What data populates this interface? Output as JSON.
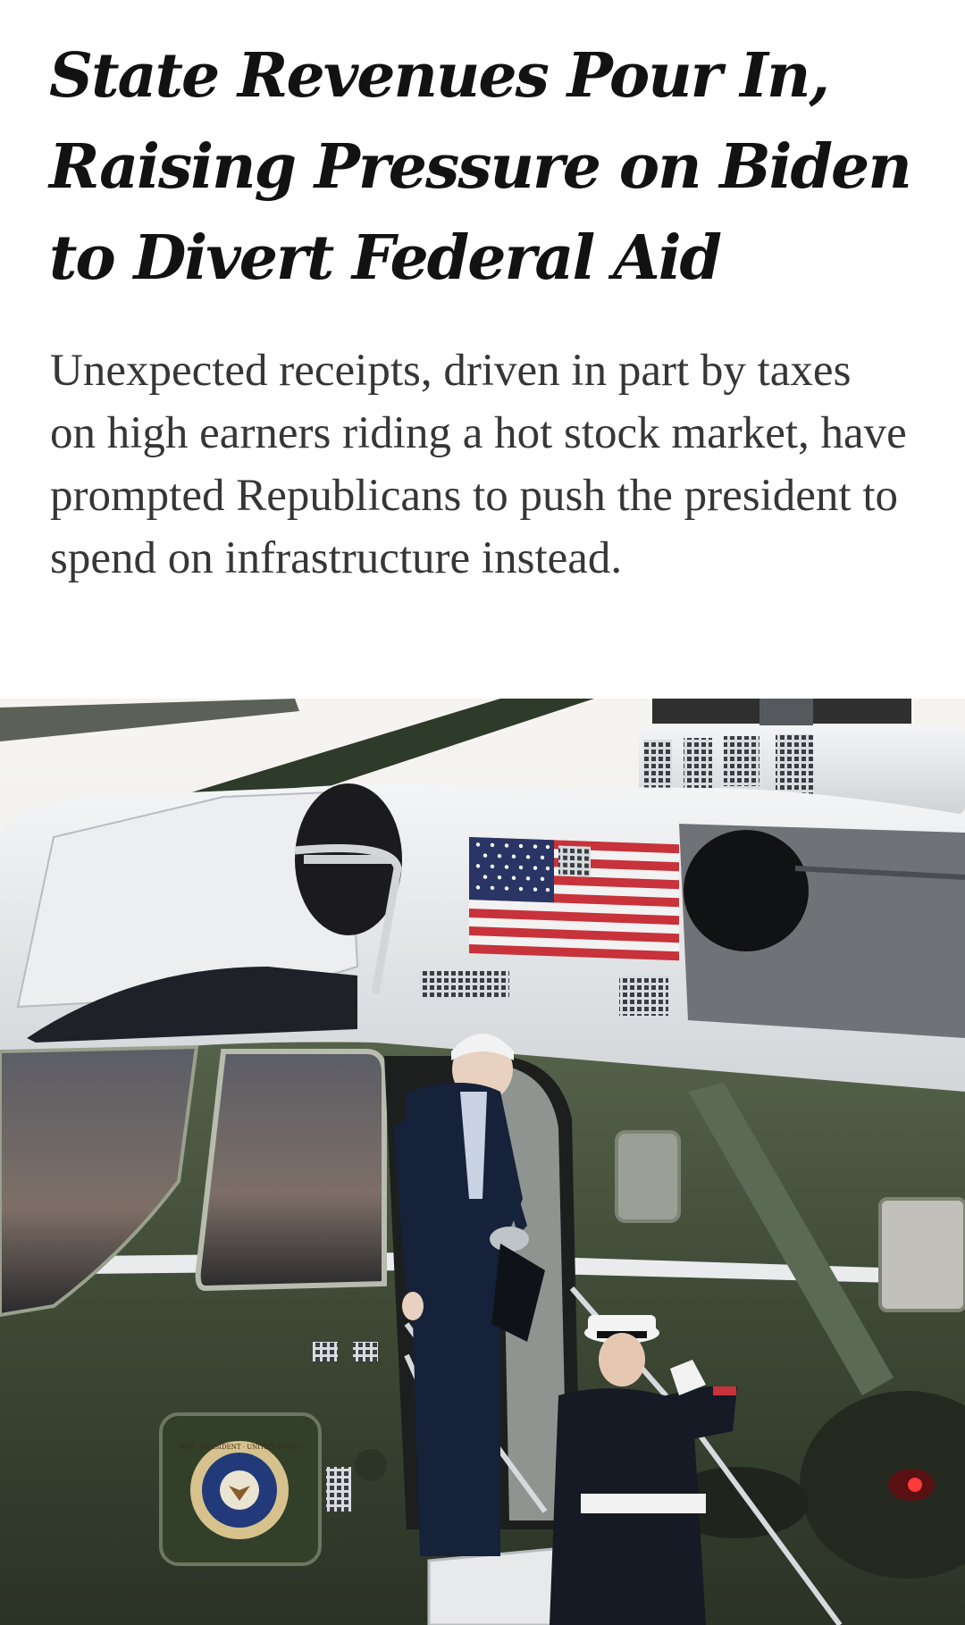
{
  "article": {
    "headline": "State Revenues Pour In, Raising Pressure on Biden to Divert Federal Aid",
    "summary": "Unexpected receipts, driven in part by taxes on high earners riding a hot stock market, have prompted Republicans to push the president to spend on infrastructure instead."
  },
  "photo": {
    "seal_text": "SEAL OF THE PRESIDENT OF THE UNITED STATES",
    "colors": {
      "sky": "#f3f1ee",
      "helicopter_white": "#e9eaec",
      "helicopter_green": "#3f4b36",
      "marine_uniform": "#151a24",
      "flag_red": "#c8323b",
      "flag_blue": "#2a3566"
    }
  }
}
